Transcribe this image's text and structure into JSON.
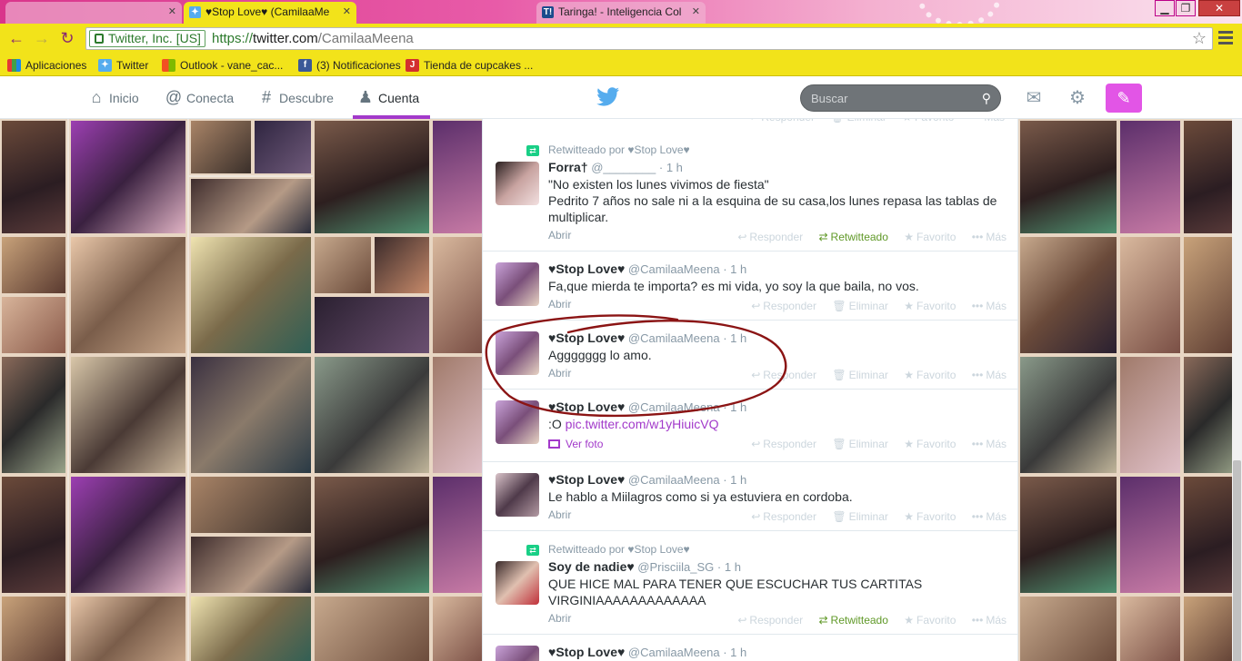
{
  "browser": {
    "tabs": [
      {
        "title": "",
        "active": false
      },
      {
        "title": "♥Stop Love♥ (CamilaaMe",
        "active": true,
        "icon": "twitter-bird-icon"
      },
      {
        "title": "Taringa! - Inteligencia Col",
        "active": false,
        "icon": "taringa-icon"
      }
    ],
    "ev_label": "Twitter, Inc. [US]",
    "url_scheme": "https://",
    "url_host": "twitter.com",
    "url_path": "/CamilaaMeena",
    "bookmarks": [
      {
        "label": "Aplicaciones",
        "icon": "apps-grid-icon"
      },
      {
        "label": "Twitter",
        "icon": "twitter-bird-icon"
      },
      {
        "label": "Outlook - vane_cac...",
        "icon": "windows-logo-icon"
      },
      {
        "label": "(3) Notificaciones",
        "icon": "facebook-icon"
      },
      {
        "label": "Tienda de cupcakes ...",
        "icon": "j-logo-icon"
      }
    ]
  },
  "twitter_nav": {
    "home": "Inicio",
    "connect": "Conecta",
    "discover": "Descubre",
    "account": "Cuenta",
    "search_placeholder": "Buscar"
  },
  "labels": {
    "reply": "Responder",
    "delete": "Eliminar",
    "favorite": "Favorito",
    "more": "Más",
    "retweeted": "Retwitteado",
    "expand": "Abrir",
    "view_photo": "Ver foto"
  },
  "colors": {
    "accent": "#a239ca",
    "retweet_green": "#609928",
    "annotation_circle": "#8b1414"
  },
  "tweets": [
    {
      "context": "Retwitteado por ♥Stop Love♥",
      "fullname": "Forra†",
      "username": "@________",
      "time": "1 h",
      "lines": [
        "\"No existen los lunes vivimos de fiesta\"",
        "Pedrito 7 años no sale ni a la esquina de su casa,los lunes repasa las tablas de multiplicar."
      ],
      "own": false
    },
    {
      "fullname": "♥Stop Love♥",
      "username": "@CamilaaMeena",
      "time": "1 h",
      "lines": [
        "Fa,que mierda te importa? es mi vida, yo soy la que baila, no vos."
      ],
      "own": true
    },
    {
      "fullname": "♥Stop Love♥",
      "username": "@CamilaaMeena",
      "time": "1 h",
      "lines": [
        "Aggggggg lo amo."
      ],
      "own": true
    },
    {
      "fullname": "♥Stop Love♥",
      "username": "@CamilaaMeena",
      "time": "1 h",
      "text_prefix": ":O ",
      "link": "pic.twitter.com/w1yHiuicVQ",
      "own": true
    },
    {
      "fullname": "♥Stop Love♥",
      "username": "@CamilaaMeena",
      "time": "1 h",
      "lines": [
        "Le hablo a Miilagros como si ya estuviera en cordoba."
      ],
      "own": true
    },
    {
      "context": "Retwitteado por ♥Stop Love♥",
      "fullname": "Soy de nadie♥",
      "username": "@Prisciila_SG",
      "time": "1 h",
      "lines": [
        "QUE HICE MAL PARA TENER QUE ESCUCHAR TUS CARTITAS VIRGINIAAAAAAAAAAAAA"
      ],
      "own": false
    },
    {
      "fullname": "♥Stop Love♥",
      "username": "@CamilaaMeena",
      "time": "1 h",
      "own": true
    }
  ]
}
